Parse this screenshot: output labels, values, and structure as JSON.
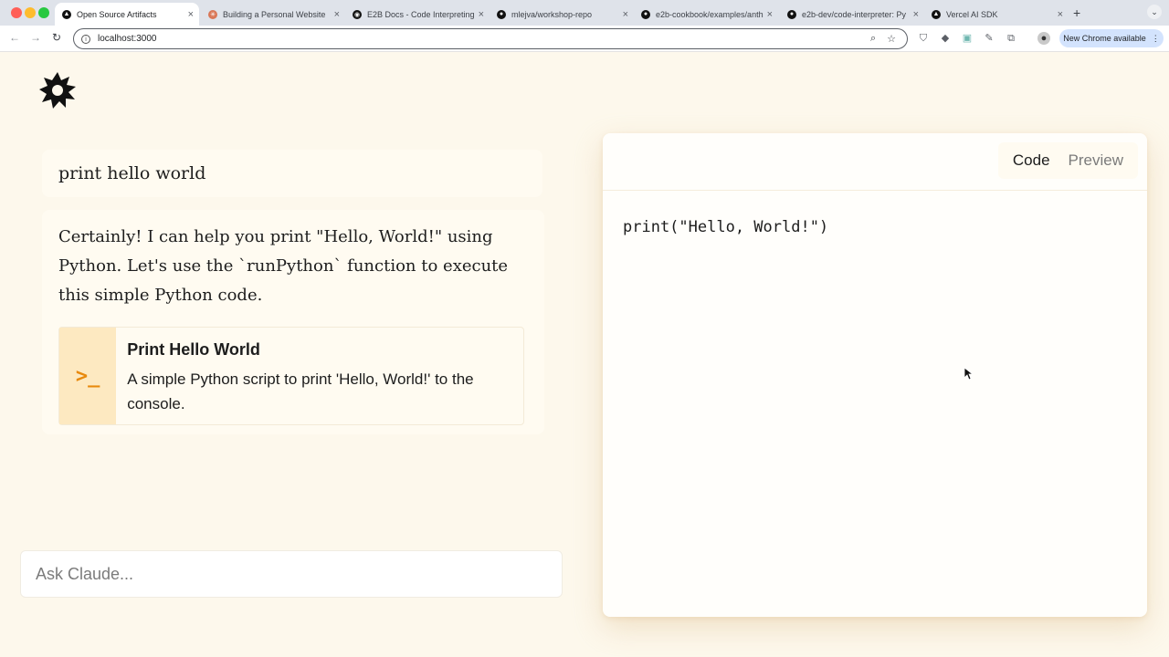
{
  "browser": {
    "tabs": [
      {
        "title": "Open Source Artifacts",
        "active": true,
        "favicon": "triangle-logo-icon"
      },
      {
        "title": "Building a Personal Website",
        "active": false,
        "favicon": "claude-icon"
      },
      {
        "title": "E2B Docs - Code Interpreting",
        "active": false,
        "favicon": "e2b-icon"
      },
      {
        "title": "mlejva/workshop-repo",
        "active": false,
        "favicon": "github-icon"
      },
      {
        "title": "e2b-cookbook/examples/anth",
        "active": false,
        "favicon": "github-icon"
      },
      {
        "title": "e2b-dev/code-interpreter: Py",
        "active": false,
        "favicon": "github-icon"
      },
      {
        "title": "Vercel AI SDK",
        "active": false,
        "favicon": "triangle-logo-icon"
      }
    ],
    "url": "localhost:3000",
    "new_chrome_label": "New Chrome available"
  },
  "chat": {
    "user_message": "print hello world",
    "assistant_message": "Certainly! I can help you print \"Hello, World!\" using Python. Let's use the `runPython` function to execute this simple Python code.",
    "artifact": {
      "icon": "terminal-icon",
      "icon_glyph": ">_",
      "title": "Print Hello World",
      "description": "A simple Python script to print 'Hello, World!' to the console."
    },
    "input_placeholder": "Ask Claude..."
  },
  "panel": {
    "tabs": {
      "code": "Code",
      "preview": "Preview"
    },
    "active_tab": "Code",
    "code": "print(\"Hello, World!\")"
  },
  "colors": {
    "page_bg": "#fdf8ec",
    "card_bg": "#fffbf1",
    "artifact_icon_bg": "#fde9c1",
    "artifact_icon_fg": "#e8890c"
  }
}
